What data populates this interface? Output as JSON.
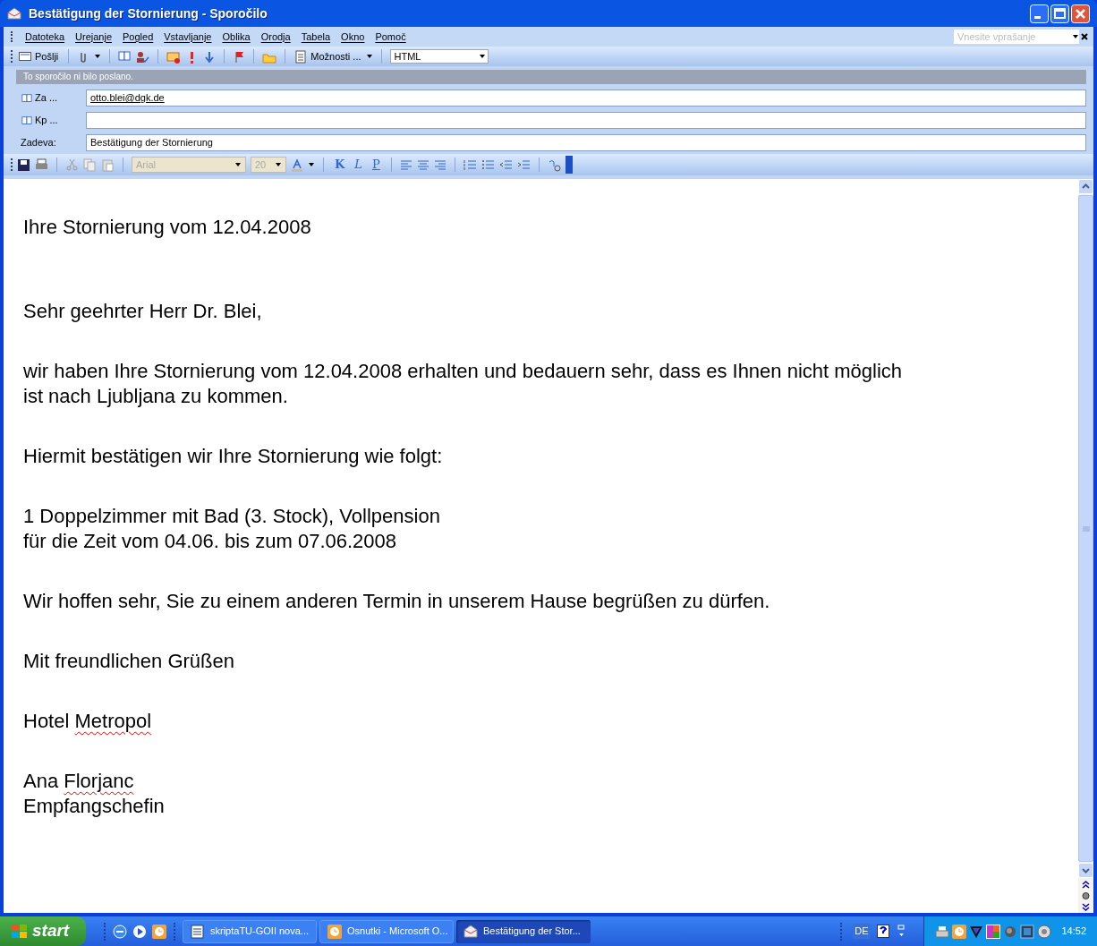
{
  "window": {
    "title": "Bestätigung der Stornierung - Sporočilo"
  },
  "menu": [
    "Datoteka",
    "Urejanje",
    "Pogled",
    "Vstavljanje",
    "Oblika",
    "Orodja",
    "Tabela",
    "Okno",
    "Pomoč"
  ],
  "help_box": {
    "placeholder": "Vnesite vprašanje"
  },
  "toolbar": {
    "send": "Pošlji",
    "options": "Možnosti ...",
    "format": "HTML"
  },
  "info_bar": "To sporočilo ni bilo poslano.",
  "header_fields": [
    {
      "label": "Za ...",
      "value": "otto.blei@dgk.de",
      "kind": "address",
      "link": true
    },
    {
      "label": "Kp ...",
      "kind": "address"
    },
    {
      "label": "Zadeva:",
      "value": "Bestätigung der Stornierung",
      "kind": "subject",
      "link": false
    }
  ],
  "format_toolbar": {
    "font": "Arial",
    "size": "20",
    "bold": "K",
    "italic": "L",
    "underline": "P"
  },
  "body": [
    [
      [
        {
          "text": "Ihre Stornierung vom 12.04.2008"
        }
      ]
    ],
    [
      [
        {
          "text": "Sehr geehrter Herr Dr. Blei,"
        }
      ]
    ],
    [
      [
        {
          "text": "wir haben Ihre Stornierung vom 12.04.2008 erhalten und bedauern sehr, dass es Ihnen nicht möglich"
        }
      ],
      [
        {
          "text": "ist nach Ljubljana zu kommen."
        }
      ]
    ],
    [
      [
        {
          "text": "Hiermit bestätigen wir Ihre Stornierung wie folgt:"
        }
      ]
    ],
    [
      [
        {
          "text": "1 Doppelzimmer mit Bad (3. Stock), Vollpension"
        }
      ],
      [
        {
          "text": "für die Zeit vom 04.06. bis zum 07.06.2008"
        }
      ]
    ],
    [
      [
        {
          "text": "Wir hoffen sehr, Sie zu einem anderen Termin in unserem Hause begrüßen zu dürfen."
        }
      ]
    ],
    [
      [
        {
          "text": "Mit freundlichen Grüßen"
        }
      ]
    ],
    [
      [
        {
          "text": "Hotel "
        },
        {
          "text": "Metropol",
          "misspelled": true
        }
      ]
    ],
    [
      [
        {
          "text": "Ana "
        },
        {
          "text": "Florjanc",
          "misspelled": true
        }
      ],
      [
        {
          "text": "Empfangschefin"
        }
      ]
    ]
  ],
  "taskbar": {
    "start": "start",
    "tasks": [
      {
        "label": "skriptaTU-GOII nova...",
        "kind": "word",
        "selected": false
      },
      {
        "label": "Osnutki - Microsoft O...",
        "kind": "outlook",
        "selected": false
      },
      {
        "label": "Bestätigung der Stor...",
        "kind": "mail",
        "selected": true
      }
    ],
    "language": "DE",
    "clock": "14:52"
  }
}
